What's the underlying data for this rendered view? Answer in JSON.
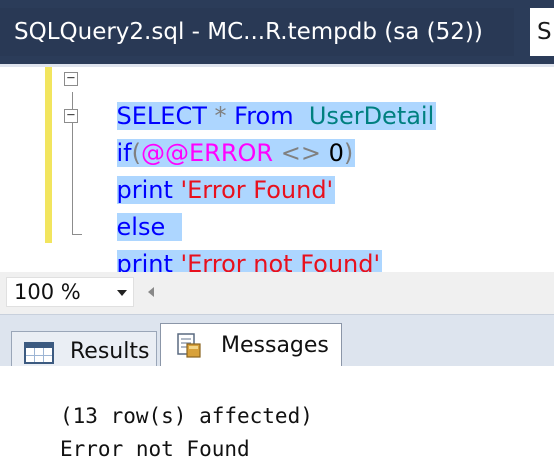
{
  "window": {
    "tab_title": "SQLQuery2.sql - MC...R.tempdb (sa (52))",
    "next_tab_partial": "S"
  },
  "editor": {
    "lines": [
      {
        "kw1": "SELECT",
        "op": " * ",
        "kw2": "From",
        "ident": "  UserDetail"
      },
      {
        "kw": "if",
        "paren_open": "(",
        "sysvar": "@@ERROR",
        "op": " <> ",
        "num": "0",
        "paren_close": ")"
      },
      {
        "kw": "print",
        "str": " 'Error Found'"
      },
      {
        "kw": "else"
      },
      {
        "kw": "print",
        "str": " 'Error not Found'"
      }
    ]
  },
  "zoom": {
    "value": "100 %"
  },
  "results_tabs": {
    "results_label": "Results",
    "messages_label": "Messages",
    "active": "Messages"
  },
  "messages": {
    "lines": [
      "(13 row(s) affected)",
      "Error not Found"
    ]
  },
  "colors": {
    "keyword": "#0000ff",
    "identifier": "#008080",
    "system_var": "#ff00ff",
    "string": "#e8101d",
    "selection": "#add6ff",
    "title_bar": "#2b3c59"
  }
}
